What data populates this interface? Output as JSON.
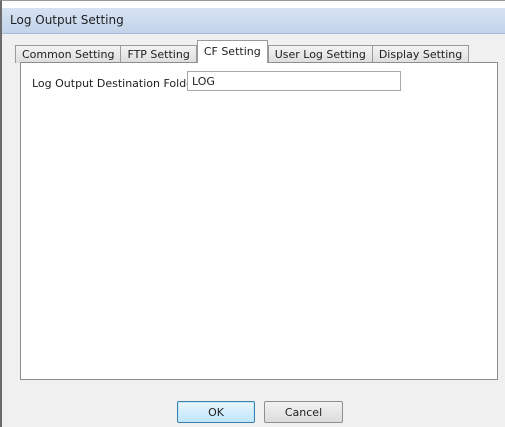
{
  "window": {
    "title": "Log Output Setting"
  },
  "tabs": [
    {
      "label": "Common Setting",
      "active": false
    },
    {
      "label": "FTP Setting",
      "active": false
    },
    {
      "label": "CF Setting",
      "active": true
    },
    {
      "label": "User Log Setting",
      "active": false
    },
    {
      "label": "Display Setting",
      "active": false
    }
  ],
  "cf_setting": {
    "destination_label": "Log Output Destination Folder",
    "destination_value": "LOG"
  },
  "buttons": {
    "ok_label": "OK",
    "cancel_label": "Cancel"
  },
  "colors": {
    "titlebar": "#c3d4ea",
    "ok_accent": "#3c7fb1"
  }
}
